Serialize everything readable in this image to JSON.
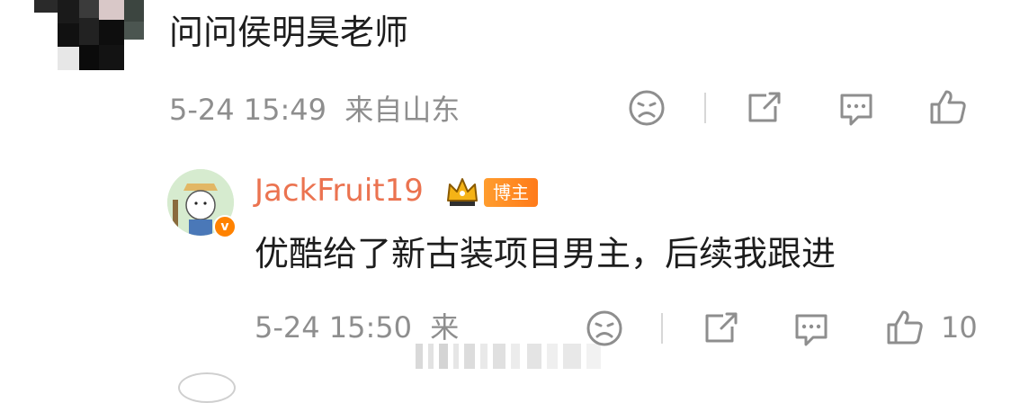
{
  "comment": {
    "text": "问问侯明昊老师",
    "timestamp": "5-24 15:49",
    "location": "来自山东"
  },
  "reply": {
    "username": "JackFruit19",
    "badge": "博主",
    "text": "优酷给了新古装项目男主，后续我跟进",
    "timestamp": "5-24 15:50",
    "location_truncated": "来",
    "like_count": "10"
  },
  "colors": {
    "username": "#eb7350",
    "meta": "#8e8e8e",
    "text": "#1d1d1d",
    "badge": "#ff8200"
  },
  "icons": [
    "dislike-face-icon",
    "share-icon",
    "comment-icon",
    "like-icon",
    "crown-icon",
    "verified-icon"
  ]
}
